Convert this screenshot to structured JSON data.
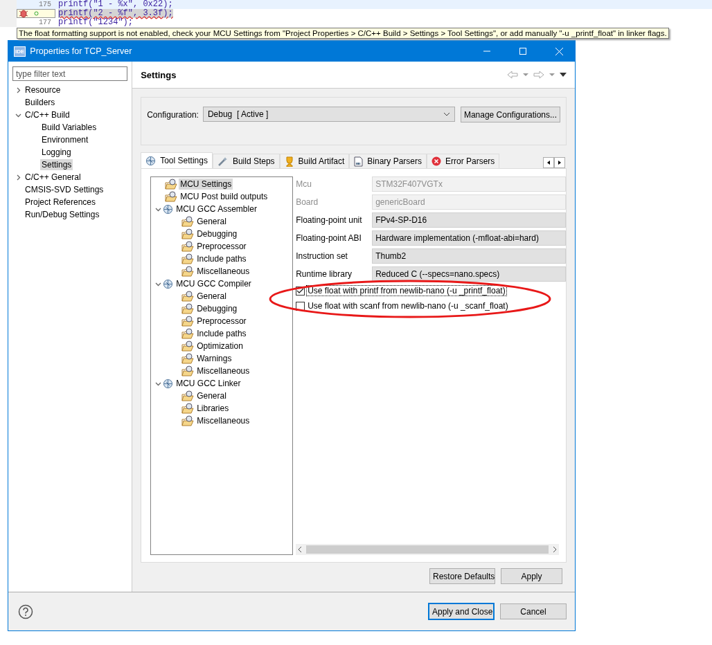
{
  "editor": {
    "lines": [
      {
        "number": "175",
        "code": "printf(\"1 - %x\", 0x22);",
        "current": true,
        "marker": false
      },
      {
        "code": "printf(\"2 - %f\", 3.3f);",
        "current": false,
        "marker": true
      },
      {
        "number": "177",
        "code": "printf(\"1234\");",
        "current": false,
        "marker": false
      }
    ],
    "tooltip": "The float formatting support is not enabled, check your MCU Settings from \"Project Properties > C/C++ Build > Settings > Tool Settings\", or add manually \"-u _printf_float\" in linker flags."
  },
  "dialog": {
    "app_badge": "IDE",
    "title": "Properties for TCP_Server",
    "filter": {
      "placeholder": "type filter text"
    },
    "nav": [
      {
        "label": "Resource",
        "expanded": false,
        "selected": false
      },
      {
        "label": "Builders",
        "selected": false
      },
      {
        "label": "C/C++ Build",
        "expanded": true,
        "selected": false,
        "children": [
          {
            "label": "Build Variables",
            "selected": false
          },
          {
            "label": "Environment",
            "selected": false
          },
          {
            "label": "Logging",
            "selected": false
          },
          {
            "label": "Settings",
            "selected": true
          }
        ]
      },
      {
        "label": "C/C++ General",
        "expanded": false,
        "selected": false
      },
      {
        "label": "CMSIS-SVD Settings",
        "selected": false
      },
      {
        "label": "Project References",
        "selected": false
      },
      {
        "label": "Run/Debug Settings",
        "selected": false
      }
    ],
    "page_title": "Settings",
    "configuration": {
      "label": "Configuration:",
      "value": "Debug  [ Active ]",
      "manage_button": "Manage Configurations..."
    },
    "tabs": [
      {
        "label": "Tool Settings",
        "selected": true
      },
      {
        "label": "Build Steps",
        "selected": false
      },
      {
        "label": "Build Artifact",
        "selected": false
      },
      {
        "label": "Binary Parsers",
        "selected": false
      },
      {
        "label": "Error Parsers",
        "selected": false
      }
    ],
    "tool_tree": [
      {
        "kind": "page",
        "label": "MCU Settings",
        "selected": true
      },
      {
        "kind": "page",
        "label": "MCU Post build outputs",
        "selected": false
      },
      {
        "kind": "category",
        "label": "MCU GCC Assembler",
        "expanded": true,
        "selected": false,
        "children": [
          {
            "kind": "page",
            "label": "General",
            "selected": false
          },
          {
            "kind": "page",
            "label": "Debugging",
            "selected": false
          },
          {
            "kind": "page",
            "label": "Preprocessor",
            "selected": false
          },
          {
            "kind": "page",
            "label": "Include paths",
            "selected": false
          },
          {
            "kind": "page",
            "label": "Miscellaneous",
            "selected": false
          }
        ]
      },
      {
        "kind": "category",
        "label": "MCU GCC Compiler",
        "expanded": true,
        "selected": false,
        "children": [
          {
            "kind": "page",
            "label": "General",
            "selected": false
          },
          {
            "kind": "page",
            "label": "Debugging",
            "selected": false
          },
          {
            "kind": "page",
            "label": "Preprocessor",
            "selected": false
          },
          {
            "kind": "page",
            "label": "Include paths",
            "selected": false
          },
          {
            "kind": "page",
            "label": "Optimization",
            "selected": false
          },
          {
            "kind": "page",
            "label": "Warnings",
            "selected": false
          },
          {
            "kind": "page",
            "label": "Miscellaneous",
            "selected": false
          }
        ]
      },
      {
        "kind": "category",
        "label": "MCU GCC Linker",
        "expanded": true,
        "selected": false,
        "children": [
          {
            "kind": "page",
            "label": "General",
            "selected": false
          },
          {
            "kind": "page",
            "label": "Libraries",
            "selected": false
          },
          {
            "kind": "page",
            "label": "Miscellaneous",
            "selected": false
          }
        ]
      }
    ],
    "fields": [
      {
        "label": "Mcu",
        "value": "STM32F407VGTx",
        "disabled": true
      },
      {
        "label": "Board",
        "value": "genericBoard",
        "disabled": true
      },
      {
        "label": "Floating-point unit",
        "value": "FPv4-SP-D16",
        "disabled": false
      },
      {
        "label": "Floating-point ABI",
        "value": "Hardware implementation (-mfloat-abi=hard)",
        "disabled": false
      },
      {
        "label": "Instruction set",
        "value": "Thumb2",
        "disabled": false
      },
      {
        "label": "Runtime library",
        "value": "Reduced C (--specs=nano.specs)",
        "disabled": false
      }
    ],
    "checkboxes": [
      {
        "label": "Use float with printf from newlib-nano (-u _printf_float)",
        "checked": true,
        "focused": true
      },
      {
        "label": "Use float with scanf from newlib-nano (-u _scanf_float)",
        "checked": false,
        "focused": false
      }
    ],
    "page_buttons": [
      "Restore Defaults",
      "Apply"
    ],
    "apply_close": "Apply and Close",
    "cancel": "Cancel"
  }
}
